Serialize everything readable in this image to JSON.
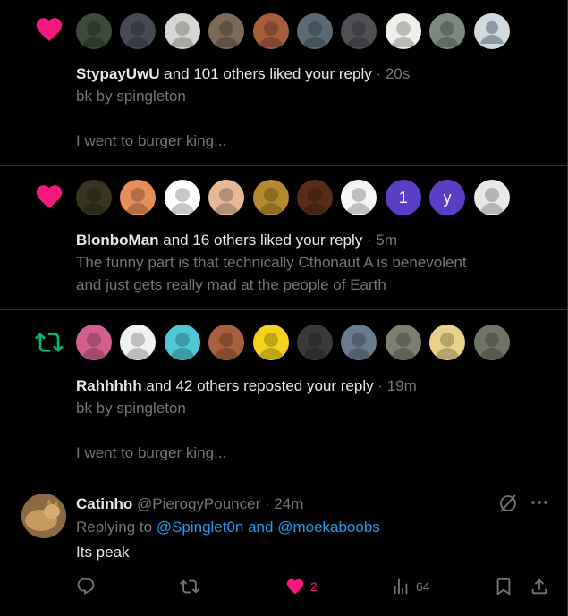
{
  "notifications": [
    {
      "type": "like",
      "actor": "StypayUwU",
      "rest": " and 101 others liked your reply",
      "time": "20s",
      "text_lines": [
        "bk by spingleton",
        "",
        "I went to burger king..."
      ],
      "avatar_colors": [
        "#3c4a3a",
        "#444b52",
        "#d5d8d2",
        "#7b6a57",
        "#a55d3c",
        "#5a6b75",
        "#4e5055",
        "#f0efec",
        "#7b8a7c",
        "#cfd9de"
      ],
      "avatar_letters": [
        "",
        "",
        "",
        "",
        "",
        "",
        "",
        "",
        "",
        ""
      ]
    },
    {
      "type": "like",
      "actor": "BlonboMan",
      "rest": " and 16 others liked your reply",
      "time": "5m",
      "text_lines": [
        "The funny part is that technically Cthonaut A is benevolent",
        "and just gets really mad at the people of Earth"
      ],
      "avatar_colors": [
        "#3a3520",
        "#e58e5a",
        "#ffffff",
        "#e6b89a",
        "#b48a2e",
        "#5a2d18",
        "#f5f5f5",
        "#5b3ec6",
        "#5b3ec6",
        "#e8e8e8"
      ],
      "avatar_letters": [
        "",
        "",
        "",
        "",
        "",
        "",
        "",
        "1",
        "y",
        ""
      ]
    },
    {
      "type": "repost",
      "actor": "Rahhhhh",
      "rest": " and 42 others reposted your reply",
      "time": "19m",
      "text_lines": [
        "bk by spingleton",
        "",
        "I went to burger king..."
      ],
      "avatar_colors": [
        "#d35f8f",
        "#f2f2f2",
        "#4fc7d7",
        "#a85f3b",
        "#f5d21e",
        "#3a3a3a",
        "#6a7b8c",
        "#7d7d70",
        "#e6d28a",
        "#6f7466"
      ],
      "avatar_letters": [
        "",
        "",
        "",
        "",
        "",
        "",
        "",
        "",
        "",
        ""
      ]
    }
  ],
  "tweet": {
    "name": "Catinho",
    "handle": "@PierogyPouncer",
    "time": "24m",
    "replying_prefix": "Replying to ",
    "replying_to": "@Spinglet0n and @moekaboobs",
    "text": "Its peak",
    "likes": "2",
    "views": "64"
  },
  "colors": {
    "like": "#f91880",
    "repost": "#00ba7c",
    "muted": "#71767b",
    "link": "#1d9bf0"
  },
  "icons": {
    "n1": "heart-icon",
    "n2": "heart-icon",
    "n3": "repost-icon"
  }
}
